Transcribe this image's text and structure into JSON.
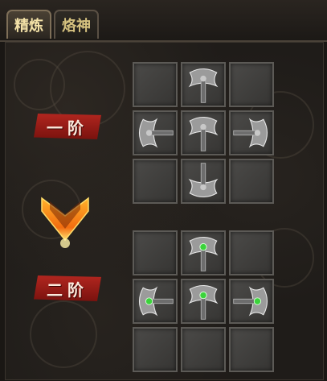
{
  "tabs": [
    {
      "label": "精炼",
      "active": true
    },
    {
      "label": "烙神",
      "active": false
    }
  ],
  "stages": {
    "first": "一阶",
    "second": "二阶"
  },
  "colors": {
    "accent_red": "#a01c18",
    "gem_green": "#3bd33b",
    "gem_silver": "#c8c8c8",
    "arrow_orange": "#f28a14"
  },
  "icons": {
    "stage_arrow": "down-arrow-icon",
    "axe": "battle-axe-icon"
  },
  "layout": {
    "first_stage": [
      [
        "",
        "axe-up",
        ""
      ],
      [
        "axe-left",
        "axe-up",
        "axe-right"
      ],
      [
        "",
        "axe-down",
        ""
      ]
    ],
    "second_stage": [
      [
        "",
        "axe-up-gem",
        ""
      ],
      [
        "axe-left-gem",
        "axe-up-gem",
        "axe-right-gem"
      ],
      [
        "",
        "",
        ""
      ]
    ]
  }
}
